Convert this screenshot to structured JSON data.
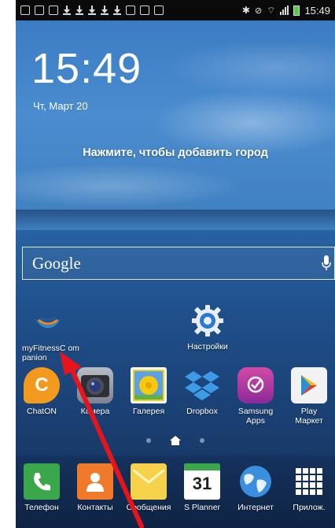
{
  "status_bar": {
    "time": "15:49"
  },
  "weather_widget": {
    "time": "15:49",
    "date": "Чт, Март 20",
    "add_city_prompt": "Нажмите, чтобы добавить город"
  },
  "search_bar": {
    "label": "Google",
    "mic_icon": "microphone-icon"
  },
  "home_apps": [
    {
      "label": "myFitnessC ompanion",
      "icon": "myfitness-logo-icon"
    },
    {
      "label": "Настройки",
      "icon": "gear-icon"
    }
  ],
  "app_row": [
    {
      "label": "ChatON",
      "icon": "chaton-icon"
    },
    {
      "label": "Камера",
      "icon": "camera-icon"
    },
    {
      "label": "Галерея",
      "icon": "gallery-icon"
    },
    {
      "label": "Dropbox",
      "icon": "dropbox-icon"
    },
    {
      "label": "Samsung Apps",
      "icon": "samsung-apps-icon"
    },
    {
      "label": "Play Маркет",
      "icon": "play-store-icon"
    }
  ],
  "dock": [
    {
      "label": "Телефон",
      "icon": "phone-icon"
    },
    {
      "label": "Контакты",
      "icon": "contacts-icon"
    },
    {
      "label": "Сообщения",
      "icon": "messages-icon"
    },
    {
      "label": "S Planner",
      "icon": "calendar-icon",
      "badge": "31"
    },
    {
      "label": "Интернет",
      "icon": "globe-icon"
    },
    {
      "label": "Прилож.",
      "icon": "apps-grid-icon"
    }
  ],
  "colors": {
    "annotation_arrow": "#e8141c",
    "chaton": "#f39a1e",
    "phone": "#3aa84a",
    "contacts": "#f07a2a"
  }
}
